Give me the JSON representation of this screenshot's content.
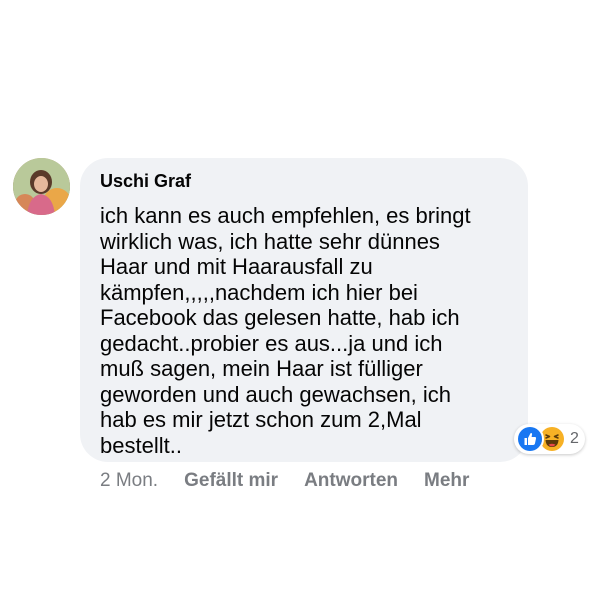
{
  "comment": {
    "author": "Uschi Graf",
    "text": "ich kann es auch empfehlen, es bringt\nwirklich was, ich hatte sehr dünnes\nHaar und mit Haarausfall zu\nkämpfen,,,,,nachdem ich hier bei\nFacebook das gelesen hatte, hab ich\ngedacht..probier es aus...ja und ich\nmuß sagen, mein Haar ist fülliger\ngeworden und auch gewachsen, ich\nhab es mir jetzt schon zum 2,Mal\nbestellt..",
    "reactions": {
      "types": [
        "like",
        "haha"
      ],
      "count": "2",
      "colors": {
        "like": "#1877f2",
        "haha": "#f7b125"
      }
    },
    "meta": {
      "timestamp": "2 Mon.",
      "like_label": "Gefällt mir",
      "reply_label": "Antworten",
      "more_label": "Mehr"
    }
  },
  "colors": {
    "bubble_bg": "#f0f2f5",
    "text": "#050505",
    "meta_text": "#7a7d82"
  }
}
